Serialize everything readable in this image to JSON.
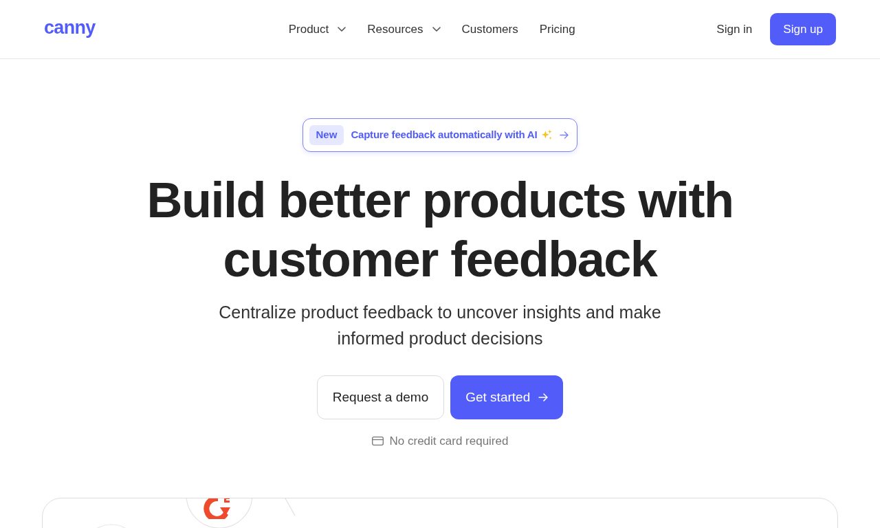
{
  "nav": {
    "logo": "canny",
    "links": [
      {
        "label": "Product",
        "kind": "dropdown"
      },
      {
        "label": "Resources",
        "kind": "dropdown"
      },
      {
        "label": "Customers",
        "kind": "link"
      },
      {
        "label": "Pricing",
        "kind": "link"
      }
    ],
    "sign_in": "Sign in",
    "sign_up": "Sign up"
  },
  "announcement": {
    "tag": "New",
    "text": "Capture feedback automatically with AI"
  },
  "hero": {
    "title": "Build better products with customer feedback",
    "subtitle": "Centralize product feedback to uncover insights and make informed product decisions",
    "buttons": [
      {
        "label": "Request a demo",
        "kind": "secondary"
      },
      {
        "label": "Get started",
        "kind": "primary"
      }
    ],
    "note": "No credit card required"
  }
}
